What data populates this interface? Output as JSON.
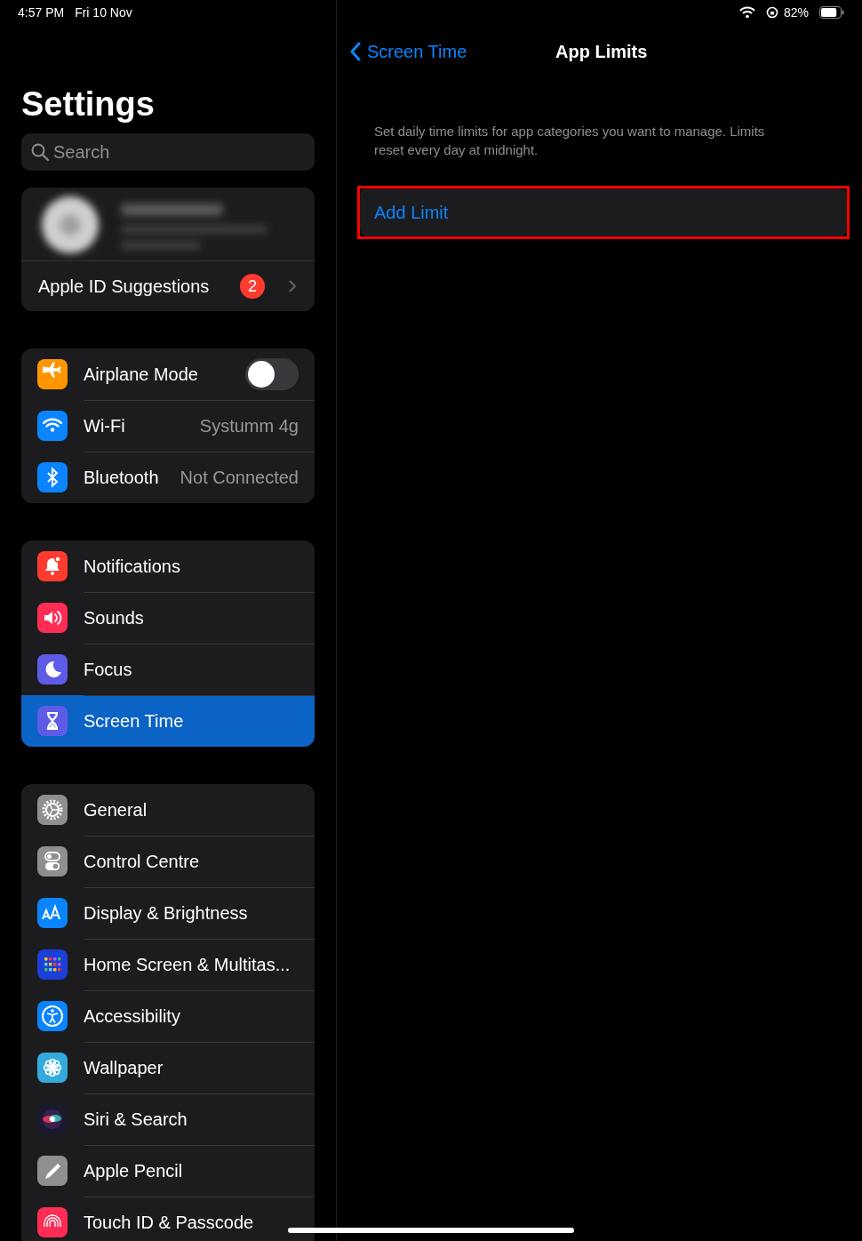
{
  "status_bar": {
    "time": "4:57 PM",
    "date": "Fri 10 Nov",
    "battery": "82%"
  },
  "sidebar": {
    "title": "Settings",
    "search": {
      "placeholder": "Search"
    },
    "account": {
      "suggestions": {
        "label": "Apple ID Suggestions",
        "badge": "2"
      }
    },
    "groups": [
      [
        {
          "label": "Airplane Mode",
          "kind": "toggle",
          "on": false,
          "selected": false
        },
        {
          "label": "Wi-Fi",
          "kind": "value",
          "value": "Systumm 4g",
          "selected": false
        },
        {
          "label": "Bluetooth",
          "kind": "value",
          "value": "Not Connected",
          "selected": false
        }
      ],
      [
        {
          "label": "Notifications",
          "kind": "plain",
          "selected": false
        },
        {
          "label": "Sounds",
          "kind": "plain",
          "selected": false
        },
        {
          "label": "Focus",
          "kind": "plain",
          "selected": false
        },
        {
          "label": "Screen Time",
          "kind": "plain",
          "selected": true
        }
      ],
      [
        {
          "label": "General",
          "kind": "plain",
          "selected": false
        },
        {
          "label": "Control Centre",
          "kind": "plain",
          "selected": false
        },
        {
          "label": "Display & Brightness",
          "kind": "plain",
          "selected": false
        },
        {
          "label": "Home Screen & Multitas...",
          "kind": "plain",
          "selected": false
        },
        {
          "label": "Accessibility",
          "kind": "plain",
          "selected": false
        },
        {
          "label": "Wallpaper",
          "kind": "plain",
          "selected": false
        },
        {
          "label": "Siri & Search",
          "kind": "plain",
          "selected": false
        },
        {
          "label": "Apple Pencil",
          "kind": "plain",
          "selected": false
        },
        {
          "label": "Touch ID & Passcode",
          "kind": "plain",
          "selected": false
        }
      ]
    ]
  },
  "detail": {
    "back": "Screen Time",
    "title": "App Limits",
    "description": "Set daily time limits for app categories you want to manage. Limits reset every day at midnight.",
    "add_limit": {
      "label": "Add Limit",
      "highlighted": true
    }
  }
}
